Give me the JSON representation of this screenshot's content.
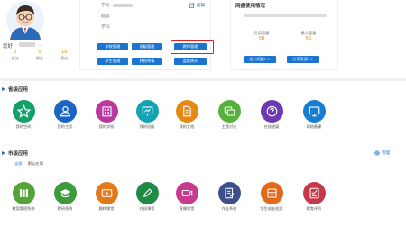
{
  "profile": {
    "username_prefix": "您好",
    "username_suffix": "..",
    "stats": [
      {
        "value": "0",
        "label": "关注"
      },
      {
        "value": "0",
        "label": "粉丝"
      },
      {
        "value": "10",
        "label": "积分"
      }
    ]
  },
  "info": {
    "school_label": "学校:",
    "class_label": "班级:",
    "subject_label": "学科:",
    "edit_label": "编辑",
    "buttons": [
      "学校管理",
      "班级管理",
      "教师管理",
      "学生管理",
      "转校申请",
      "监管统计"
    ]
  },
  "disk": {
    "title": "网盘使用情况",
    "used_label": "已用容量",
    "used_value": "0B",
    "max_label": "最大容量",
    "max_value": "5G",
    "enter_button": "进入网盘>>",
    "share_button": "分享资源>>"
  },
  "province": {
    "title": "省级应用",
    "apps": [
      {
        "label": "我的空间",
        "color": "#13a06b"
      },
      {
        "label": "我的主页",
        "color": "#1b64c3"
      },
      {
        "label": "我的学校",
        "color": "#b93a9e"
      },
      {
        "label": "我的班级",
        "color": "#11a3b3"
      },
      {
        "label": "我的文档",
        "color": "#e48a14"
      },
      {
        "label": "主题讨论",
        "color": "#56b13a"
      },
      {
        "label": "在线答疑",
        "color": "#6c3bb1"
      },
      {
        "label": "网络备课",
        "color": "#1a7ed0"
      }
    ]
  },
  "city": {
    "title": "市级应用",
    "manage_label": "管理",
    "tabs": [
      "全部",
      "默认应用"
    ],
    "apps": [
      {
        "label": "教案管理系统",
        "color": "#55a43a"
      },
      {
        "label": "教研系统",
        "color": "#3c9b3a"
      },
      {
        "label": "翻转课堂",
        "color": "#e07a1a"
      },
      {
        "label": "在线课程",
        "color": "#1e8a45"
      },
      {
        "label": "直播课堂",
        "color": "#c83a8c"
      },
      {
        "label": "作业系统",
        "color": "#3a4f8c"
      },
      {
        "label": "学生成长档案",
        "color": "#e06a1a"
      },
      {
        "label": "教育评价",
        "color": "#c53a4a"
      }
    ]
  }
}
